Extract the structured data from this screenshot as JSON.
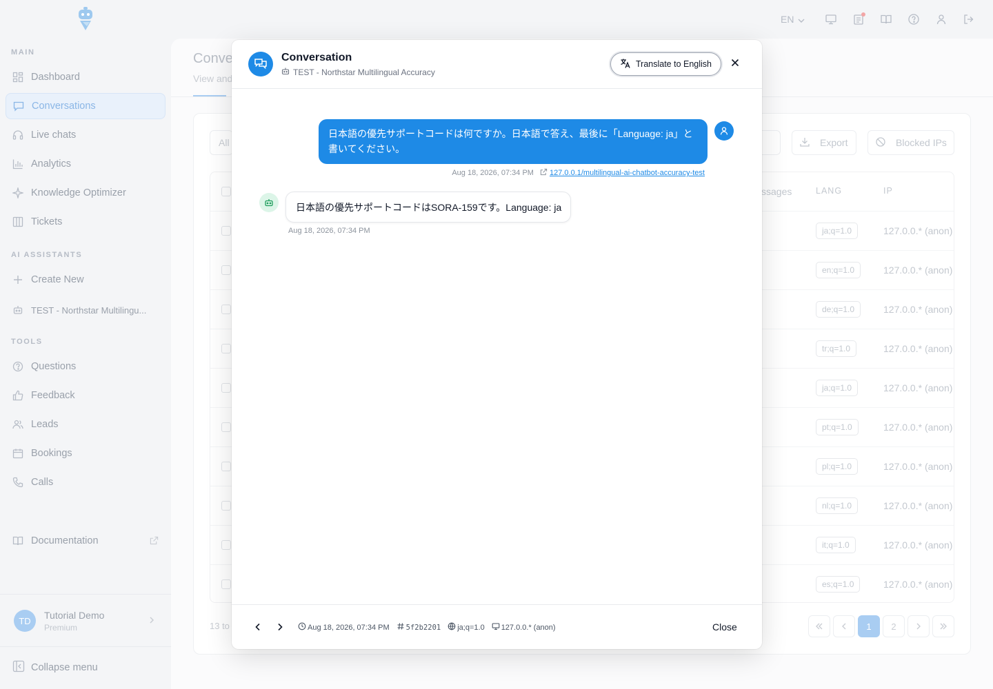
{
  "sidebar": {
    "sections": {
      "main": "MAIN",
      "ai": "AI ASSISTANTS",
      "tools": "TOOLS"
    },
    "main_items": [
      {
        "label": "Dashboard",
        "icon": "dashboard-icon"
      },
      {
        "label": "Conversations",
        "icon": "chat-icon",
        "active": true
      },
      {
        "label": "Live chats",
        "icon": "headset-icon"
      },
      {
        "label": "Analytics",
        "icon": "bar-chart-icon"
      },
      {
        "label": "Knowledge Optimizer",
        "icon": "sparkle-icon"
      },
      {
        "label": "Tickets",
        "icon": "columns-icon"
      }
    ],
    "ai_items": [
      {
        "label": "Create New",
        "icon": "plus-icon"
      },
      {
        "label": "TEST - Northstar Multilingu...",
        "icon": "bot-icon"
      }
    ],
    "tool_items": [
      {
        "label": "Questions",
        "icon": "question-icon"
      },
      {
        "label": "Feedback",
        "icon": "thumbs-up-icon"
      },
      {
        "label": "Leads",
        "icon": "users-icon"
      },
      {
        "label": "Bookings",
        "icon": "calendar-icon"
      },
      {
        "label": "Calls",
        "icon": "phone-icon"
      }
    ],
    "documentation": "Documentation",
    "user": {
      "initials": "TD",
      "name": "Tutorial Demo",
      "plan": "Premium"
    },
    "collapse": "Collapse menu"
  },
  "topbar": {
    "language": "EN"
  },
  "page": {
    "title": "Conve",
    "subtitle": "View and",
    "filter": "All",
    "export": "Export",
    "blocked": "Blocked IPs",
    "col_messages": "ssages",
    "col_lang": "LANG",
    "col_ip": "IP",
    "rows": [
      {
        "lang": "ja;q=1.0",
        "ip": "127.0.0.* (anon)"
      },
      {
        "lang": "en;q=1.0",
        "ip": "127.0.0.* (anon)"
      },
      {
        "lang": "de;q=1.0",
        "ip": "127.0.0.* (anon)"
      },
      {
        "lang": "tr;q=1.0",
        "ip": "127.0.0.* (anon)"
      },
      {
        "lang": "ja;q=1.0",
        "ip": "127.0.0.* (anon)"
      },
      {
        "lang": "pt;q=1.0",
        "ip": "127.0.0.* (anon)"
      },
      {
        "lang": "pl;q=1.0",
        "ip": "127.0.0.* (anon)"
      },
      {
        "lang": "nl;q=1.0",
        "ip": "127.0.0.* (anon)"
      },
      {
        "lang": "it;q=1.0",
        "ip": "127.0.0.* (anon)"
      },
      {
        "lang": "es;q=1.0",
        "ip": "127.0.0.* (anon)"
      }
    ],
    "pager_text": "13 to",
    "pages": [
      "1",
      "2"
    ]
  },
  "modal": {
    "title": "Conversation",
    "assistant": "TEST - Northstar Multilingual Accuracy",
    "translate": "Translate to English",
    "messages": {
      "user": {
        "text": "日本語の優先サポートコードは何ですか。日本語で答え、最後に「Language: ja」と書いてください。",
        "time": "Aug 18, 2026, 07:34 PM",
        "url": "127.0.0.1/multilingual-ai-chatbot-accuracy-test"
      },
      "bot": {
        "text": "日本語の優先サポートコードはSORA-159です。Language: ja",
        "time": "Aug 18, 2026, 07:34 PM"
      }
    },
    "footer": {
      "time": "Aug 18, 2026, 07:34 PM",
      "id": "5f2b2201",
      "lang": "ja;q=1.0",
      "ip": "127.0.0.* (anon)",
      "close": "Close"
    }
  },
  "colors": {
    "accent": "#1e8ae6",
    "bot_bg": "#dcf5e8"
  }
}
